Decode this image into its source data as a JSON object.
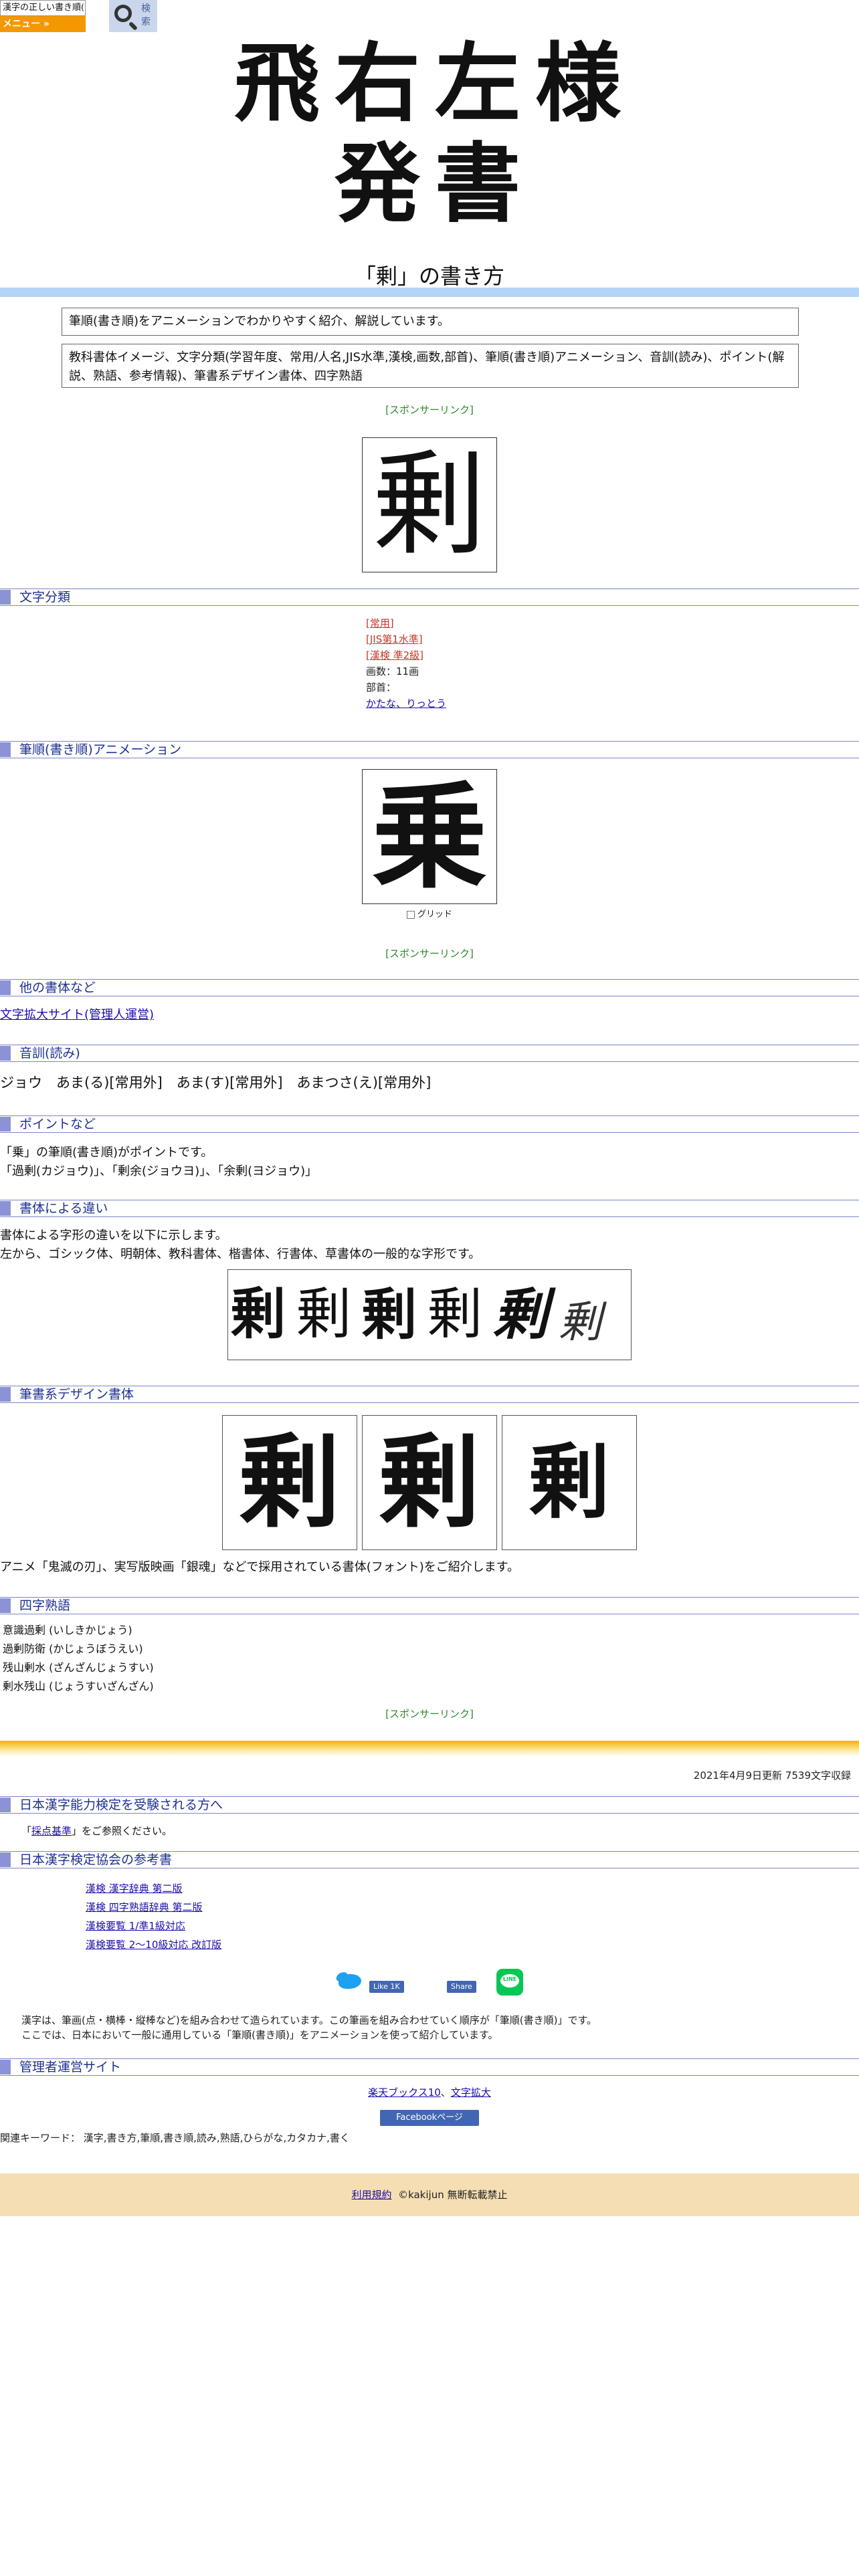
{
  "header": {
    "logo_text": "漢字の正しい書き順(筆順)",
    "menu_label": "メニュー »",
    "search_label": "検索",
    "banner_title": "飛右左様発書"
  },
  "page": {
    "title": "「剰」の書き方",
    "intro_line1": "筆順(書き順)をアニメーションでわかりやすく紹介、解説しています。",
    "intro_line2": "教科書体イメージ、文字分類(学習年度、常用/人名,JIS水準,漢検,画数,部首)、筆順(書き順)アニメーション、音訓(読み)、ポイント(解説、熟語、参考情報)、筆書系デザイン書体、四字熟語",
    "main_char": "剰",
    "sponsor_label": "[スポンサーリンク]"
  },
  "sections": {
    "classification": "文字分類",
    "animation": "筆順(書き順)アニメーション",
    "other_fonts": "他の書体など",
    "reading": "音訓(読み)",
    "points": "ポイントなど",
    "font_diff": "書体による違い",
    "design_fonts": "筆書系デザイン書体",
    "idioms": "四字熟語",
    "kanken_takers": "日本漢字能力検定を受験される方へ",
    "kanken_refs": "日本漢字検定協会の参考書",
    "admin_sites": "管理者運営サイト"
  },
  "classification": {
    "joyo": "[常用]",
    "jis": "[JIS第1水準]",
    "kanken": "[漢検 準2級]",
    "strokes": "画数：11画",
    "radical_label": "部首：",
    "radical_value": "かたな、りっとう"
  },
  "animation": {
    "char": "乗",
    "grid_label": "グリッド"
  },
  "other_fonts": {
    "link": "文字拡大サイト(管理人運営)"
  },
  "reading": {
    "text": "ジョウ　あま(る)[常用外]　あま(す)[常用外]　あまつさ(え)[常用外]"
  },
  "points": {
    "line1": "「乗」の筆順(書き順)がポイントです。",
    "line2": "「過剰(カジョウ)」、「剰余(ジョウヨ)」、「余剰(ヨジョウ)」"
  },
  "font_diff": {
    "line1": "書体による字形の違いを以下に示します。",
    "line2": "左から、ゴシック体、明朝体、教科書体、楷書体、行書体、草書体の一般的な字形です。",
    "chars": [
      "剰",
      "剰",
      "剰",
      "剰",
      "剰",
      "剰"
    ]
  },
  "design_fonts": {
    "chars": [
      "剰",
      "剰",
      "剰"
    ],
    "caption": "アニメ「鬼滅の刃」、実写版映画「銀魂」などで採用されている書体(フォント)をご紹介します。"
  },
  "idioms": {
    "items": [
      "意識過剰 (いしきかじょう)",
      "過剰防衛 (かじょうぼうえい)",
      "残山剰水 (ざんざんじょうすい)",
      "剰水残山 (じょうすいざんざん)"
    ]
  },
  "footer_info": {
    "update": "2021年4月9日更新 7539文字収録",
    "kanken_note_pre": "「",
    "kanken_note_link": "採点基準",
    "kanken_note_post": "」をご参照ください。",
    "refs": [
      "漢検 漢字辞典 第二版",
      "漢検 四字熟語辞典 第二版",
      "漢検要覧 1/準1級対応",
      "漢検要覧 2～10級対応 改訂版"
    ],
    "fb_like": "Like 1K",
    "fb_share": "Share",
    "line_label": "LINE",
    "explain1": "漢字は、筆画(点・横棒・縦棒など)を組み合わせて造られています。この筆画を組み合わせていく順序が「筆順(書き順)」です。",
    "explain2": "ここでは、日本において一般に通用している「筆順(書き順)」をアニメーションを使って紹介しています。",
    "admin_link1": "楽天ブックス10",
    "admin_sep": "、",
    "admin_link2": "文字拡大",
    "fb_page": "Facebookページ",
    "keywords": "関連キーワード： 漢字,書き方,筆順,書き順,読み,熟語,ひらがな,カタカナ,書く",
    "terms_link": "利用規約",
    "copyright": "©kakijun 無断転載禁止"
  },
  "colors": {
    "banner": "#f5deb3",
    "menu": "#f39800",
    "section_mark": "#8b93d6",
    "section_text": "#1e3192",
    "title_bar": "#b3d4f5",
    "sponsor": "#2a8a2a",
    "category_red": "#c0392b"
  }
}
